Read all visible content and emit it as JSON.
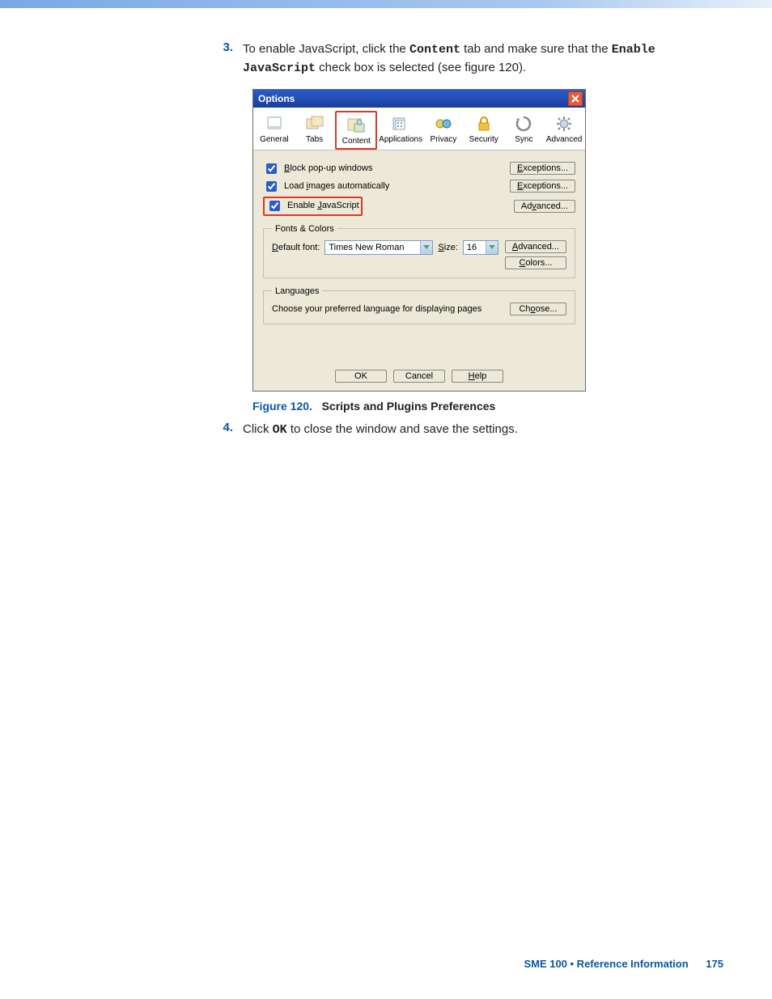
{
  "steps": {
    "s3_num": "3.",
    "s3_pre": "To enable JavaScript, click the ",
    "s3_content": "Content",
    "s3_mid": " tab and make sure that the ",
    "s3_enablejs": "Enable JavaScript",
    "s3_post": " check box is selected (see figure 120).",
    "s4_num": "4.",
    "s4_pre": "Click ",
    "s4_ok": "OK",
    "s4_post": " to close the window and save the settings."
  },
  "figure": {
    "label": "Figure 120.",
    "text": "Scripts and Plugins Preferences"
  },
  "dialog": {
    "title": "Options",
    "tabs": {
      "general": "General",
      "tabs": "Tabs",
      "content": "Content",
      "applications": "Applications",
      "privacy": "Privacy",
      "security": "Security",
      "sync": "Sync",
      "advanced": "Advanced"
    },
    "checks": {
      "block_popup": "Block pop-up windows",
      "load_images": "Load images automatically",
      "enable_js": "Enable JavaScript"
    },
    "buttons": {
      "exceptions": "Exceptions...",
      "advanced": "Advanced...",
      "colors": "Colors...",
      "choose": "Choose...",
      "ok": "OK",
      "cancel": "Cancel",
      "help": "Help"
    },
    "fonts_colors": {
      "legend": "Fonts & Colors",
      "default_font_label": "Default font:",
      "default_font_value": "Times New Roman",
      "size_label": "Size:",
      "size_value": "16"
    },
    "languages": {
      "legend": "Languages",
      "text": "Choose your preferred language for displaying pages"
    }
  },
  "footer": {
    "a": "SME 100 • Reference Information",
    "b": "175"
  }
}
